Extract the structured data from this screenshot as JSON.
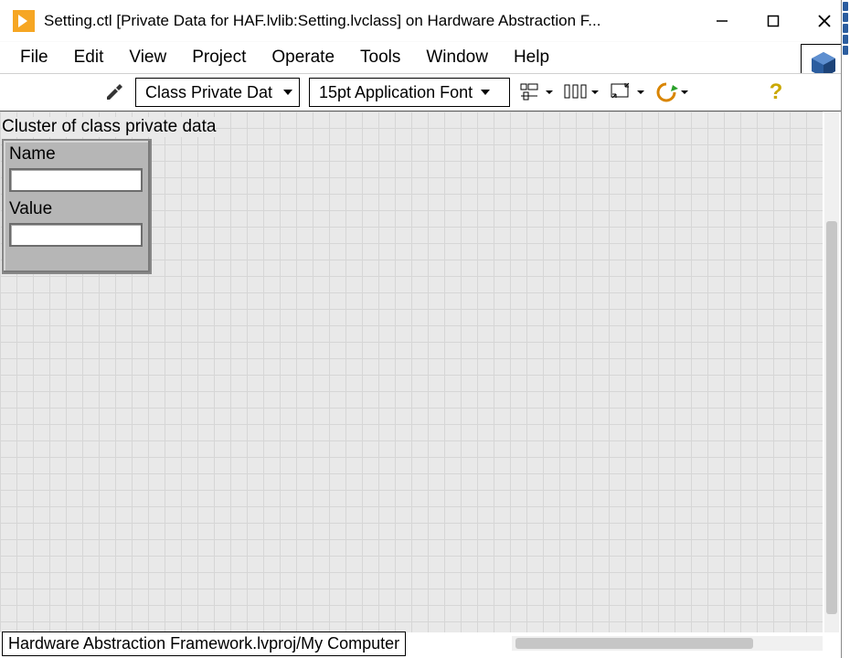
{
  "window": {
    "title": "Setting.ctl [Private Data for HAF.lvlib:Setting.lvclass] on Hardware Abstraction F..."
  },
  "menu": {
    "file": "File",
    "edit": "Edit",
    "view": "View",
    "project": "Project",
    "operate": "Operate",
    "tools": "Tools",
    "window": "Window",
    "help": "Help"
  },
  "toolbar": {
    "combo1": "Class Private Dat",
    "font_combo": "15pt Application Font"
  },
  "panel": {
    "cluster_title": "Cluster of class private data",
    "field1_label": "Name",
    "field1_value": "",
    "field2_label": "Value",
    "field2_value": ""
  },
  "status": {
    "path": "Hardware Abstraction Framework.lvproj/My Computer"
  },
  "icons": {
    "minimize": "minimize-icon",
    "maximize": "maximize-restore-icon",
    "close": "close-icon",
    "wrench": "customize-icon",
    "classcube": "class-cube-icon",
    "dropdown": "chevron-down-icon",
    "align": "align-objects-icon",
    "distribute": "distribute-objects-icon",
    "resize": "resize-objects-icon",
    "reorder": "reorder-icon",
    "helpq": "context-help-icon"
  }
}
